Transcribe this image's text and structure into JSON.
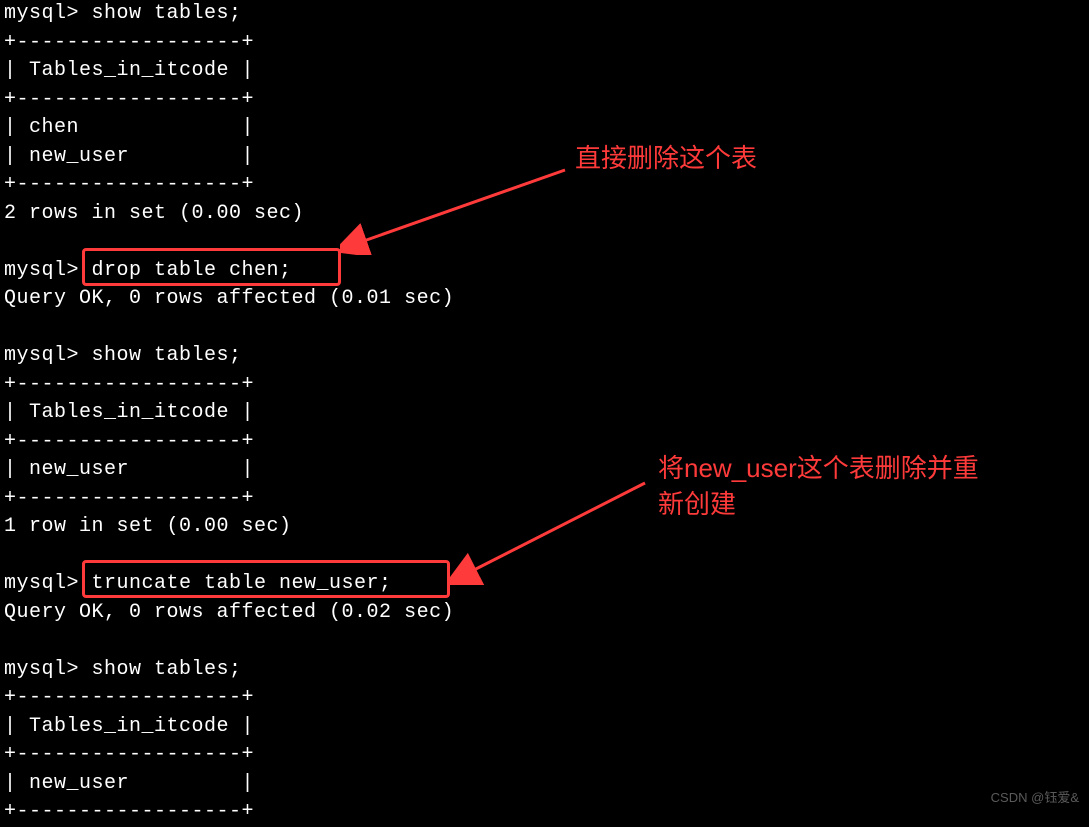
{
  "terminal": {
    "lines": [
      "mysql> show tables;",
      "+------------------+",
      "| Tables_in_itcode |",
      "+------------------+",
      "| chen             |",
      "| new_user         |",
      "+------------------+",
      "2 rows in set (0.00 sec)",
      "",
      "mysql> drop table chen;",
      "Query OK, 0 rows affected (0.01 sec)",
      "",
      "mysql> show tables;",
      "+------------------+",
      "| Tables_in_itcode |",
      "+------------------+",
      "| new_user         |",
      "+------------------+",
      "1 row in set (0.00 sec)",
      "",
      "mysql> truncate table new_user;",
      "Query OK, 0 rows affected (0.02 sec)",
      "",
      "mysql> show tables;",
      "+------------------+",
      "| Tables_in_itcode |",
      "+------------------+",
      "| new_user         |",
      "+------------------+"
    ]
  },
  "annotations": {
    "label1": "直接删除这个表",
    "label2_line1": "将new_user这个表删除并重",
    "label2_line2": "新创建"
  },
  "watermark": "CSDN @钰爱&"
}
